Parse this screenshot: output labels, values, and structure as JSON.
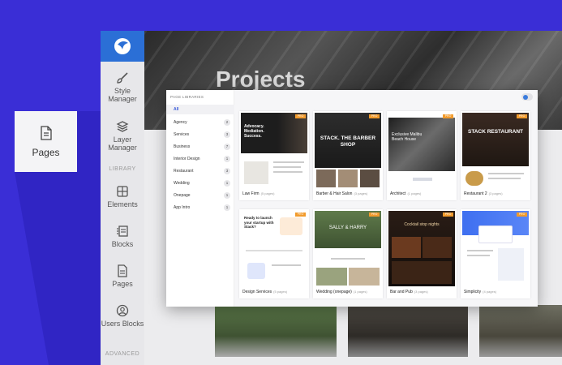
{
  "floating_card": {
    "label": "Pages",
    "icon": "document-icon"
  },
  "sidebar": {
    "logo_icon": "hummingbird-logo-icon",
    "items": [
      {
        "label": "Style Manager",
        "icon": "brush-icon"
      },
      {
        "label": "Layer Manager",
        "icon": "layers-icon"
      },
      {
        "label": "Elements",
        "icon": "grid-icon"
      },
      {
        "label": "Blocks",
        "icon": "blocks-icon"
      },
      {
        "label": "Pages",
        "icon": "document-icon"
      },
      {
        "label": "Users Blocks",
        "icon": "user-icon"
      }
    ],
    "section_library": "LIBRARY",
    "section_advanced": "ADVANCED"
  },
  "stage": {
    "title": "Projects"
  },
  "modal": {
    "heading": "PAGE LIBRARIES",
    "all_label": "All",
    "categories": [
      {
        "name": "Agency",
        "count": "2"
      },
      {
        "name": "Services",
        "count": "3"
      },
      {
        "name": "Business",
        "count": "7"
      },
      {
        "name": "Interior Design",
        "count": "1"
      },
      {
        "name": "Restaurant",
        "count": "3"
      },
      {
        "name": "Wedding",
        "count": "1"
      },
      {
        "name": "Onepage",
        "count": "1"
      },
      {
        "name": "App Intro",
        "count": "1"
      }
    ],
    "badge": "PRO",
    "cards": [
      {
        "title": "Law Firm",
        "pages": "(5 pages)",
        "thumb_text": "Advocacy. Mediation. Success."
      },
      {
        "title": "Barber & Hair Salon",
        "pages": "(3 pages)",
        "thumb_text": "STACK. THE BARBER SHOP"
      },
      {
        "title": "Architect",
        "pages": "(1 pages)",
        "thumb_text": "Exclusive Malibu Beach House"
      },
      {
        "title": "Restaurant 2",
        "pages": "(3 pages)",
        "thumb_text": "STACK RESTAURANT"
      },
      {
        "title": "Design Services",
        "pages": "(5 pages)",
        "thumb_text": "Ready to launch your startup with Stack?"
      },
      {
        "title": "Wedding (onepage)",
        "pages": "(1 pages)",
        "thumb_text": "SALLY & HARRY"
      },
      {
        "title": "Bar and Pub",
        "pages": "(3 pages)",
        "thumb_text": "Cocktail stop nights"
      },
      {
        "title": "Simplicity",
        "pages": "(4 pages)",
        "thumb_text": ""
      }
    ]
  },
  "colors": {
    "background": "#3a2ed6",
    "accent": "#2b6fd6",
    "badge": "#f29b2c"
  }
}
